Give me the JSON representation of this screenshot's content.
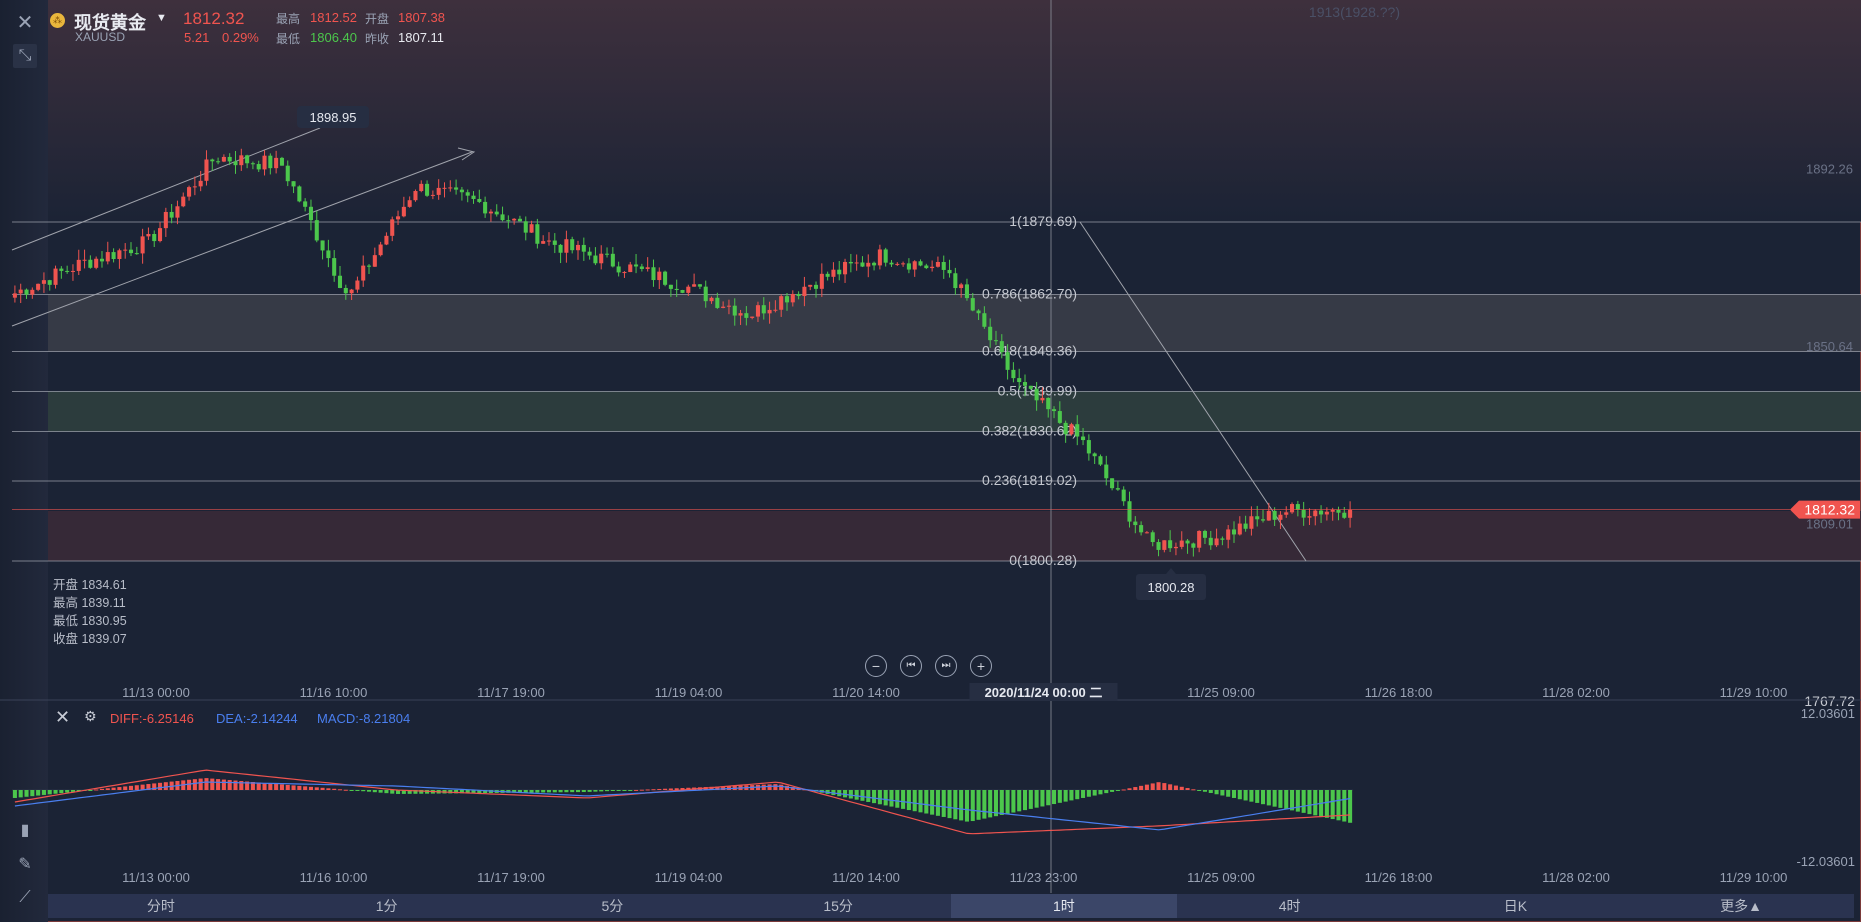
{
  "header": {
    "coin_icon": "gold-coin-icon",
    "name": "现货黄金",
    "symbol": "XAUUSD",
    "price": "1812.32",
    "change": "5.21",
    "change_pct": "0.29%",
    "high_label": "最高",
    "high": "1812.52",
    "low_label": "最低",
    "low": "1806.40",
    "open_label": "开盘",
    "open": "1807.38",
    "prev_close_label": "昨收",
    "prev_close": "1807.11"
  },
  "colors": {
    "up": "#f0544f",
    "down": "#4cc74c",
    "diff": "#f0544f",
    "dea": "#4a7ff0",
    "macd": "#4a7ff0"
  },
  "ohlc": {
    "open": "开盘 1834.61",
    "high": "最高 1839.11",
    "low": "最低 1830.95",
    "close": "收盘 1839.07"
  },
  "fib_levels": [
    {
      "ratio": "1",
      "value": 1879.69,
      "label": "1(1879.69)"
    },
    {
      "ratio": "0.786",
      "value": 1862.7,
      "label": "0.786(1862.70)"
    },
    {
      "ratio": "0.618",
      "value": 1849.36,
      "label": "0.618(1849.36)"
    },
    {
      "ratio": "0.5",
      "value": 1839.99,
      "label": "0.5(1839.99)"
    },
    {
      "ratio": "0.382",
      "value": 1830.62,
      "label": "0.382(1830.62)"
    },
    {
      "ratio": "0.236",
      "value": 1819.02,
      "label": "0.236(1819.02)"
    },
    {
      "ratio": "0",
      "value": 1800.28,
      "label": "0(1800.28)"
    }
  ],
  "price_axis": {
    "top_label": "1913(1928.??)",
    "labels": [
      "1892.26",
      "1850.64",
      "1809.01"
    ],
    "current": "1812.32",
    "bottom": "1767.72"
  },
  "markers": {
    "high": "1898.95",
    "low": "1800.28"
  },
  "xaxis": [
    "11/13 00:00",
    "11/16 10:00",
    "11/17 19:00",
    "11/19 04:00",
    "11/20 14:00",
    "2020/11/24 00:00 二",
    "11/25 09:00",
    "11/26 18:00",
    "11/28 02:00",
    "11/29 10:00"
  ],
  "macd": {
    "diff_label": "DIFF:-6.25146",
    "dea_label": "DEA:-2.14244",
    "macd_label": "MACD:-8.21804",
    "top": "12.03601",
    "bottom": "-12.03601",
    "xaxis": [
      "11/13 00:00",
      "11/16 10:00",
      "11/17 19:00",
      "11/19 04:00",
      "11/20 14:00",
      "11/23 23:00",
      "11/25 09:00",
      "11/26 18:00",
      "11/28 02:00",
      "11/29 10:00"
    ]
  },
  "timeframes": [
    "分时",
    "1分",
    "5分",
    "15分",
    "1时",
    "4时",
    "日K",
    "更多▲"
  ],
  "active_timeframe": "1时",
  "chart_data": {
    "type": "candlestick",
    "symbol": "XAUUSD",
    "interval": "1时",
    "ylim": [
      1767.72,
      1913
    ],
    "price_key_points": [
      {
        "t": "11/12 17:00",
        "price": 1863
      },
      {
        "t": "11/13 00:00",
        "price": 1870
      },
      {
        "t": "11/13 16:00",
        "price": 1875
      },
      {
        "t": "11/16 03:00",
        "price": 1895
      },
      {
        "t": "11/16 10:00",
        "price": 1893
      },
      {
        "t": "11/16 16:00",
        "price": 1862
      },
      {
        "t": "11/17 00:00",
        "price": 1888
      },
      {
        "t": "11/17 19:00",
        "price": 1884
      },
      {
        "t": "11/18 10:00",
        "price": 1875
      },
      {
        "t": "11/19 00:00",
        "price": 1870
      },
      {
        "t": "11/19 10:00",
        "price": 1865
      },
      {
        "t": "11/19 20:00",
        "price": 1858
      },
      {
        "t": "11/20 14:00",
        "price": 1866
      },
      {
        "t": "11/22 23:00",
        "price": 1872
      },
      {
        "t": "11/23 20:00",
        "price": 1868
      },
      {
        "t": "11/23 23:00",
        "price": 1842
      },
      {
        "t": "11/24 10:00",
        "price": 1828
      },
      {
        "t": "11/24 16:00",
        "price": 1804
      },
      {
        "t": "11/25 09:00",
        "price": 1806
      },
      {
        "t": "11/25 20:00",
        "price": 1812
      },
      {
        "t": "11/26 10:00",
        "price": 1812.32
      }
    ],
    "macd_key_points": [
      {
        "t": "11/13 00:00",
        "diff": -3,
        "dea": -4,
        "hist": -2
      },
      {
        "t": "11/16 10:00",
        "diff": 5,
        "dea": 2,
        "hist": 3
      },
      {
        "t": "11/17 19:00",
        "diff": 0,
        "dea": 1,
        "hist": -1
      },
      {
        "t": "11/19 04:00",
        "diff": -2,
        "dea": -1.5,
        "hist": -0.5
      },
      {
        "t": "11/20 14:00",
        "diff": 2,
        "dea": 1,
        "hist": 1.5
      },
      {
        "t": "11/23 23:00",
        "diff": -11,
        "dea": -5,
        "hist": -8
      },
      {
        "t": "11/25 09:00",
        "diff": -9,
        "dea": -10,
        "hist": 2
      },
      {
        "t": "11/26 10:00",
        "diff": -6.25,
        "dea": -2.14,
        "hist": -8.22
      }
    ]
  }
}
